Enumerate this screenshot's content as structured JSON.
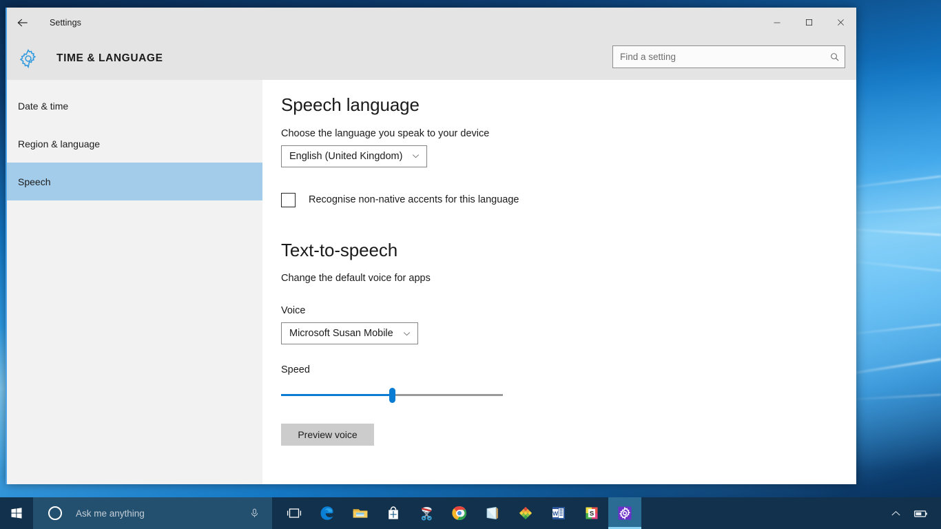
{
  "window": {
    "title": "Settings",
    "page_title": "TIME & LANGUAGE",
    "back_icon": "back-arrow-icon",
    "gear_icon": "gear-icon",
    "controls": {
      "minimize": "minimize-icon",
      "maximize": "maximize-icon",
      "close": "close-icon"
    }
  },
  "search": {
    "placeholder": "Find a setting",
    "value": "",
    "icon": "search-icon"
  },
  "sidebar": {
    "items": [
      {
        "label": "Date & time",
        "selected": false
      },
      {
        "label": "Region & language",
        "selected": false
      },
      {
        "label": "Speech",
        "selected": true
      }
    ]
  },
  "content": {
    "speech_language": {
      "heading": "Speech language",
      "description": "Choose the language you speak to your device",
      "language_value": "English (United Kingdom)",
      "checkbox_label": "Recognise non-native accents for this language",
      "checkbox_checked": false
    },
    "text_to_speech": {
      "heading": "Text-to-speech",
      "description": "Change the default voice for apps",
      "voice_label": "Voice",
      "voice_value": "Microsoft Susan Mobile",
      "speed_label": "Speed",
      "speed_percent": 50,
      "preview_label": "Preview voice"
    }
  },
  "taskbar": {
    "start_icon": "windows-start-icon",
    "cortana": {
      "placeholder": "Ask me anything",
      "circle_icon": "cortana-circle-icon",
      "mic_icon": "microphone-icon"
    },
    "apps": [
      {
        "name": "task-view",
        "label": "Task View"
      },
      {
        "name": "edge",
        "label": "Microsoft Edge"
      },
      {
        "name": "file-explorer",
        "label": "File Explorer"
      },
      {
        "name": "store",
        "label": "Store"
      },
      {
        "name": "snipping-tool",
        "label": "Snipping Tool"
      },
      {
        "name": "chrome",
        "label": "Google Chrome"
      },
      {
        "name": "onenote",
        "label": "OneNote"
      },
      {
        "name": "colour-app",
        "label": "Colour App"
      },
      {
        "name": "word",
        "label": "Word"
      },
      {
        "name": "sublime",
        "label": "Sublime Text"
      },
      {
        "name": "settings",
        "label": "Settings",
        "active": true
      }
    ],
    "tray": {
      "show_hidden_icon": "chevron-up-icon",
      "battery_icon": "battery-icon"
    }
  },
  "colors": {
    "accent": "#0a7cd3",
    "selection": "#a3ccea",
    "taskbar": "#12314c",
    "header_band": "#e4e4e4",
    "sidebar": "#f2f2f2"
  }
}
